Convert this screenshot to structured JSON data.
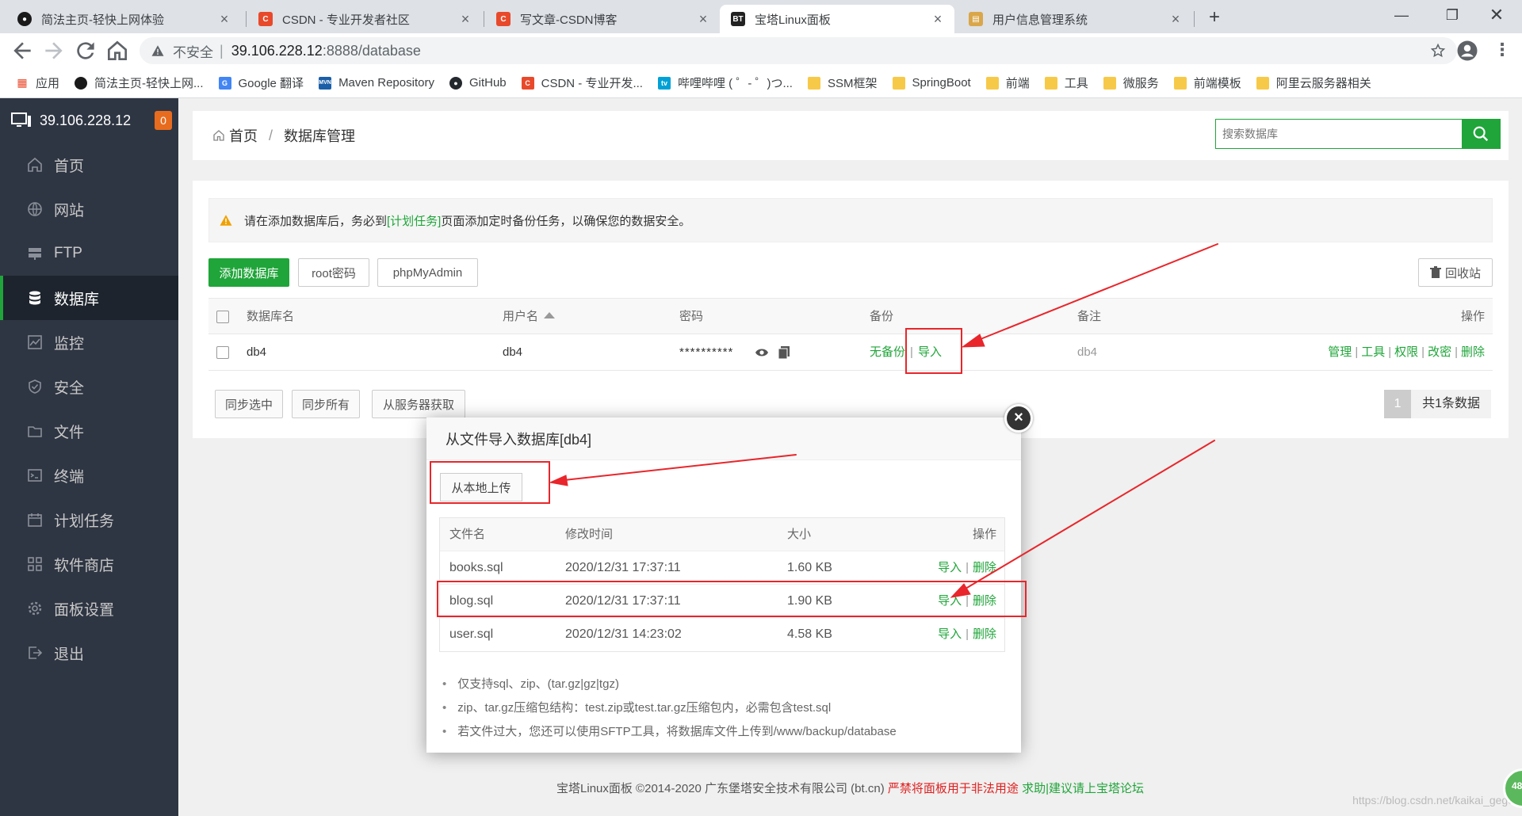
{
  "browser": {
    "tabs": [
      {
        "title": "简法主页-轻快上网体验",
        "icon": "jianfa-icon",
        "active": false
      },
      {
        "title": "CSDN - 专业开发者社区",
        "icon": "csdn-icon",
        "active": false
      },
      {
        "title": "写文章-CSDN博客",
        "icon": "csdn-icon",
        "active": false
      },
      {
        "title": "宝塔Linux面板",
        "icon": "bt-icon",
        "active": true
      },
      {
        "title": "用户信息管理系统",
        "icon": "page-icon",
        "active": false
      }
    ],
    "tab_close": "×",
    "new_tab": "+",
    "address": {
      "insecure_label": "不安全",
      "host": "39.106.228.12",
      "path": ":8888/database"
    },
    "bookmarks": [
      {
        "label": "应用",
        "icon": "apps-grid-icon"
      },
      {
        "label": "简法主页-轻快上网...",
        "icon": "jianfa-icon"
      },
      {
        "label": "Google 翻译",
        "icon": "google-translate-icon"
      },
      {
        "label": "Maven Repository",
        "icon": "maven-icon"
      },
      {
        "label": "GitHub",
        "icon": "github-icon"
      },
      {
        "label": "CSDN - 专业开发...",
        "icon": "csdn-icon"
      },
      {
        "label": "哔哩哔哩 ( ゜- ゜)つ...",
        "icon": "bilibili-icon"
      },
      {
        "label": "SSM框架",
        "icon": "folder-icon"
      },
      {
        "label": "SpringBoot",
        "icon": "folder-icon"
      },
      {
        "label": "前端",
        "icon": "folder-icon"
      },
      {
        "label": "工具",
        "icon": "folder-icon"
      },
      {
        "label": "微服务",
        "icon": "folder-icon"
      },
      {
        "label": "前端模板",
        "icon": "folder-icon"
      },
      {
        "label": "阿里云服务器相关",
        "icon": "folder-icon"
      }
    ]
  },
  "sidebar": {
    "server_ip": "39.106.228.12",
    "badge": "0",
    "items": [
      {
        "label": "首页",
        "icon": "home-icon",
        "active": false
      },
      {
        "label": "网站",
        "icon": "globe-icon",
        "active": false
      },
      {
        "label": "FTP",
        "icon": "ftp-icon",
        "active": false
      },
      {
        "label": "数据库",
        "icon": "database-icon",
        "active": true
      },
      {
        "label": "监控",
        "icon": "monitor-chart-icon",
        "active": false
      },
      {
        "label": "安全",
        "icon": "shield-icon",
        "active": false
      },
      {
        "label": "文件",
        "icon": "folder-icon",
        "active": false
      },
      {
        "label": "终端",
        "icon": "terminal-icon",
        "active": false
      },
      {
        "label": "计划任务",
        "icon": "calendar-icon",
        "active": false
      },
      {
        "label": "软件商店",
        "icon": "apps-icon",
        "active": false
      },
      {
        "label": "面板设置",
        "icon": "gear-icon",
        "active": false
      },
      {
        "label": "退出",
        "icon": "logout-icon",
        "active": false
      }
    ]
  },
  "breadcrumb": {
    "home": "首页",
    "separator": "/",
    "current": "数据库管理"
  },
  "search": {
    "placeholder": "搜索数据库"
  },
  "notice": {
    "before": "请在添加数据库后，务必到",
    "link": "[计划任务]",
    "after": "页面添加定时备份任务，以确保您的数据安全。"
  },
  "buttons": {
    "add_db": "添加数据库",
    "root_pwd": "root密码",
    "phpmyadmin": "phpMyAdmin",
    "recycle": "回收站",
    "sync_selected": "同步选中",
    "sync_all": "同步所有",
    "fetch_server": "从服务器获取"
  },
  "db_table": {
    "headers": {
      "name": "数据库名",
      "user": "用户名",
      "password": "密码",
      "backup": "备份",
      "note": "备注",
      "ops": "操作"
    },
    "rows": [
      {
        "name": "db4",
        "user": "db4",
        "password": "**********",
        "backup_status": "无备份",
        "import": "导入",
        "note": "db4",
        "ops": [
          "管理",
          "工具",
          "权限",
          "改密",
          "删除"
        ]
      }
    ]
  },
  "pager": {
    "page": "1",
    "total": "共1条数据"
  },
  "modal": {
    "title": "从文件导入数据库[db4]",
    "close": "×",
    "upload_button": "从本地上传",
    "headers": {
      "file": "文件名",
      "mtime": "修改时间",
      "size": "大小",
      "ops": "操作"
    },
    "files": [
      {
        "name": "books.sql",
        "mtime": "2020/12/31 17:37:11",
        "size": "1.60 KB",
        "import": "导入",
        "delete": "删除"
      },
      {
        "name": "blog.sql",
        "mtime": "2020/12/31 17:37:11",
        "size": "1.90 KB",
        "import": "导入",
        "delete": "删除"
      },
      {
        "name": "user.sql",
        "mtime": "2020/12/31 14:23:02",
        "size": "4.58 KB",
        "import": "导入",
        "delete": "删除"
      }
    ],
    "notes": [
      "仅支持sql、zip、(tar.gz|gz|tgz)",
      "zip、tar.gz压缩包结构：test.zip或test.tar.gz压缩包内，必需包含test.sql",
      "若文件过大，您还可以使用SFTP工具，将数据库文件上传到/www/backup/database"
    ]
  },
  "footer": {
    "copyright": "宝塔Linux面板 ©2014-2020 广东堡塔安全技术有限公司 (bt.cn)",
    "warning": "严禁将面板用于非法用途",
    "help": "求助|建议请上宝塔论坛"
  },
  "watermark": "https://blog.csdn.net/kaikai_gege",
  "bubble": "48",
  "colors": {
    "accent": "#20a53a",
    "sidebar": "#2f3643",
    "annotation": "#e8262b",
    "badge": "#e86c1e"
  }
}
